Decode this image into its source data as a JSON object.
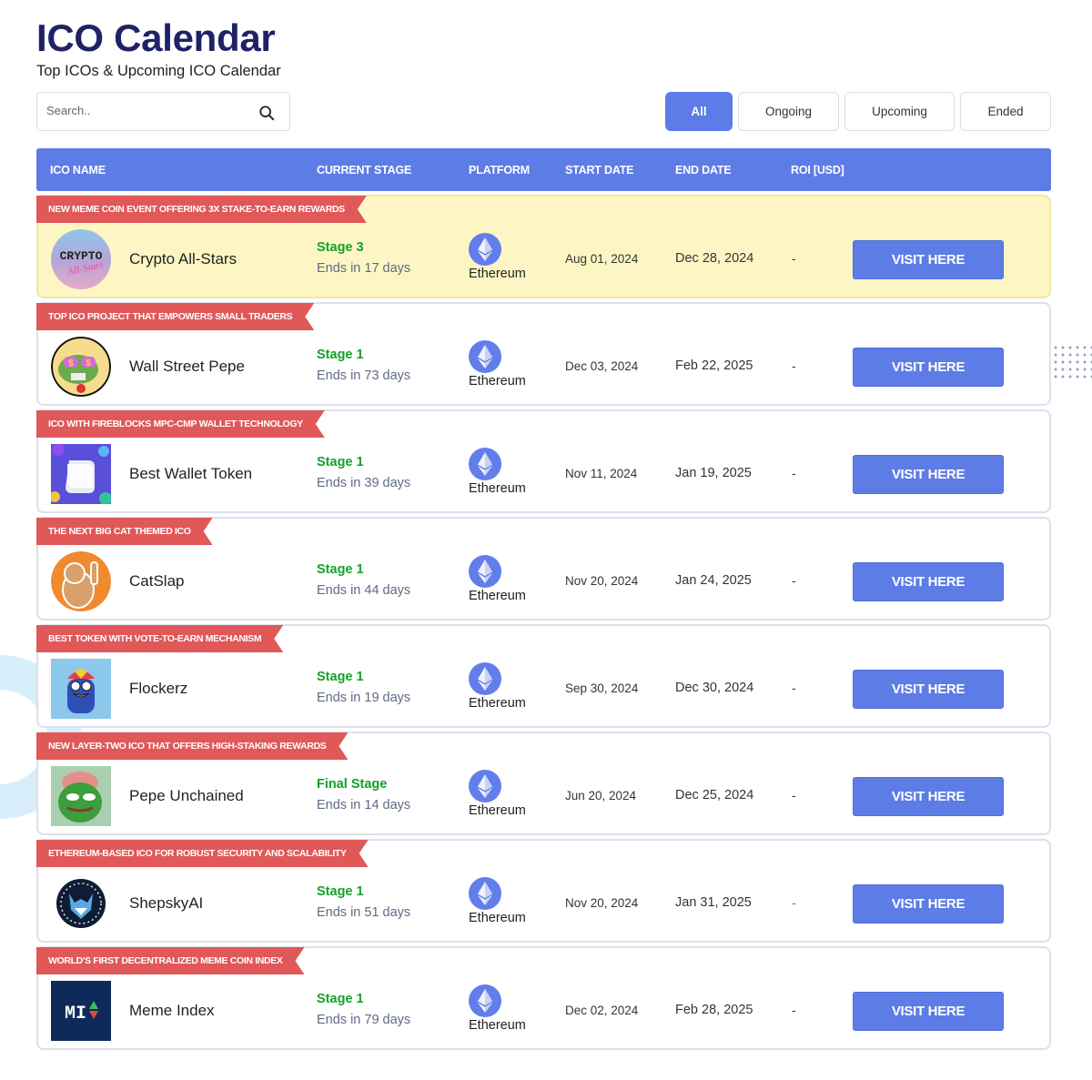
{
  "header": {
    "title": "ICO Calendar",
    "subtitle": "Top ICOs & Upcoming ICO Calendar"
  },
  "search": {
    "placeholder": "Search..",
    "value": "",
    "icon": "search-icon"
  },
  "filters": [
    {
      "label": "All",
      "active": true
    },
    {
      "label": "Ongoing",
      "active": false
    },
    {
      "label": "Upcoming",
      "active": false
    },
    {
      "label": "Ended",
      "active": false
    }
  ],
  "columns": [
    "ICO NAME",
    "CURRENT STAGE",
    "PLATFORM",
    "START DATE",
    "END DATE",
    "ROI [USD]"
  ],
  "colors": {
    "accent": "#5e7ce6",
    "title": "#1f2266",
    "ribbon": "#e05858",
    "stage_green": "#12a12a",
    "featured_bg": "#fdf6c4",
    "roi_negative": "#e04040"
  },
  "rows": [
    {
      "ribbon": "NEW MEME COIN EVENT OFFERING 3X STAKE-TO-EARN REWARDS",
      "name": "Crypto All-Stars",
      "logo": "crypto-all-stars-logo",
      "stage": "Stage 3",
      "ends": "Ends in 17 days",
      "platform": "Ethereum",
      "platform_icon": "ethereum-icon",
      "start": "Aug 01, 2024",
      "end": "Dec 28, 2024",
      "roi": "-",
      "button": "VISIT HERE",
      "featured": true
    },
    {
      "ribbon": "TOP ICO PROJECT THAT EMPOWERS SMALL TRADERS",
      "name": "Wall Street Pepe",
      "logo": "wall-street-pepe-logo",
      "stage": "Stage 1",
      "ends": "Ends in 73 days",
      "platform": "Ethereum",
      "platform_icon": "ethereum-icon",
      "start": "Dec 03, 2024",
      "end": "Feb 22, 2025",
      "roi": "-",
      "button": "VISIT HERE",
      "featured": false
    },
    {
      "ribbon": "ICO WITH FIREBLOCKS MPC-CMP WALLET TECHNOLOGY",
      "name": "Best Wallet Token",
      "logo": "best-wallet-token-logo",
      "stage": "Stage 1",
      "ends": "Ends in 39 days",
      "platform": "Ethereum",
      "platform_icon": "ethereum-icon",
      "start": "Nov 11, 2024",
      "end": "Jan 19, 2025",
      "roi": "-",
      "button": "VISIT HERE",
      "featured": false
    },
    {
      "ribbon": "THE NEXT BIG CAT THEMED ICO",
      "name": "CatSlap",
      "logo": "catslap-logo",
      "stage": "Stage 1",
      "ends": "Ends in 44 days",
      "platform": "Ethereum",
      "platform_icon": "ethereum-icon",
      "start": "Nov 20, 2024",
      "end": "Jan 24, 2025",
      "roi": "-",
      "button": "VISIT HERE",
      "featured": false
    },
    {
      "ribbon": "BEST TOKEN WITH VOTE-TO-EARN MECHANISM",
      "name": "Flockerz",
      "logo": "flockerz-logo",
      "stage": "Stage 1",
      "ends": "Ends in 19 days",
      "platform": "Ethereum",
      "platform_icon": "ethereum-icon",
      "start": "Sep 30, 2024",
      "end": "Dec 30, 2024",
      "roi": "-",
      "button": "VISIT HERE",
      "featured": false
    },
    {
      "ribbon": "NEW LAYER-TWO ICO THAT OFFERS HIGH-STAKING REWARDS",
      "name": "Pepe Unchained",
      "logo": "pepe-unchained-logo",
      "stage": "Final Stage",
      "ends": "Ends in 14 days",
      "platform": "Ethereum",
      "platform_icon": "ethereum-icon",
      "start": "Jun 20, 2024",
      "end": "Dec 25, 2024",
      "roi": "-",
      "button": "VISIT HERE",
      "featured": false
    },
    {
      "ribbon": "ETHEREUM-BASED ICO FOR ROBUST SECURITY AND SCALABILITY",
      "name": "ShepskyAI",
      "logo": "shepskyai-logo",
      "stage": "Stage 1",
      "ends": "Ends in 51 days",
      "platform": "Ethereum",
      "platform_icon": "ethereum-icon",
      "start": "Nov 20, 2024",
      "end": "Jan 31, 2025",
      "roi": "-",
      "roi_negative": true,
      "button": "VISIT HERE",
      "featured": false
    },
    {
      "ribbon": "WORLD'S FIRST DECENTRALIZED MEME COIN INDEX",
      "name": "Meme Index",
      "logo": "meme-index-logo",
      "logo_text": "MI",
      "stage": "Stage 1",
      "ends": "Ends in 79 days",
      "platform": "Ethereum",
      "platform_icon": "ethereum-icon",
      "start": "Dec 02, 2024",
      "end": "Feb 28, 2025",
      "roi": "-",
      "button": "VISIT HERE",
      "featured": false
    }
  ]
}
